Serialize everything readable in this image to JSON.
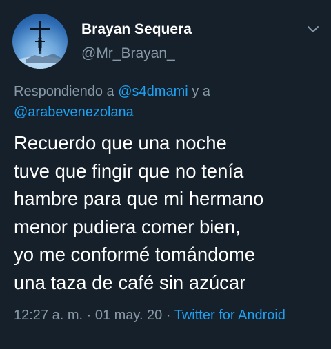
{
  "user": {
    "display_name": "Brayan Sequera",
    "handle": "@Mr_Brayan_"
  },
  "reply": {
    "prefix": "Respondiendo a ",
    "mention1": "@s4dmami",
    "joiner": " y a ",
    "mention2": "@arabevenezolana"
  },
  "tweet": {
    "text": "Recuerdo que una noche\ntuve que fingir que no tenía\nhambre para que mi hermano\nmenor pudiera comer bien,\nyo me conformé tomándome\nuna taza de café sin azúcar"
  },
  "meta": {
    "time": "12:27 a. m.",
    "sep1": " · ",
    "date": "01 may. 20",
    "sep2": " · ",
    "source": "Twitter for Android"
  },
  "icons": {
    "caret": "chevron-down-icon",
    "avatar": "avatar"
  },
  "colors": {
    "background": "#15202b",
    "primary_text": "#ffffff",
    "secondary_text": "#8899a6",
    "accent": "#1da1f2"
  }
}
